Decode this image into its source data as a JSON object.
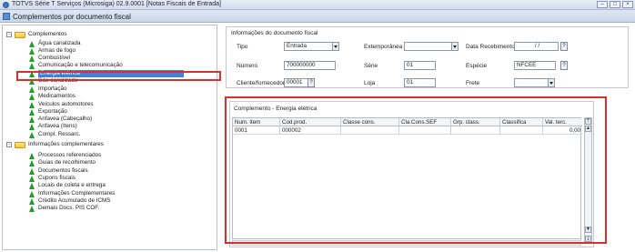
{
  "window": {
    "title": "TOTVS Série T Serviços (Microsiga) 02.9.0001 [Notas Fiscais de Entrada]",
    "min_label": "–",
    "max_label": "□",
    "close_label": "×"
  },
  "header": {
    "title": "Complementos por documento fiscal"
  },
  "tree": {
    "root1": "Complementos",
    "items1": [
      "Água canalizada",
      "Armas de fogo",
      "Combustível",
      "Comunicação e telecomunicação",
      "Energia elétrica",
      "Gás canalizado",
      "Importação",
      "Medicamentos",
      "Veículos automotores",
      "Exportação",
      "Anfavea (Cabeçalho)",
      "Anfavea (Itens)",
      "Compl. Ressarc."
    ],
    "root2": "Informações complementares",
    "items2": [
      "Processos referenciados",
      "Guias de recolhimento",
      "Documentos fiscais",
      "Cupons fiscais",
      "Locais de coleta e entrega",
      "Informações Complementares",
      "Crédito Acumulado de ICMS",
      "Demais Docs. PIS COF."
    ],
    "expander": "-"
  },
  "doc_info": {
    "title": "Informações do documento fiscal",
    "tipo_label": "Tipo",
    "tipo_value": "Entrada",
    "extemporanea_label": "Extemporânea",
    "extemporanea_value": "",
    "data_recebimento_label": "Data Recebimento",
    "data_recebimento_value": "/ /",
    "numero_label": "Número",
    "numero_value": "700000000",
    "serie_label": "Série",
    "serie_value": "01",
    "especie_label": "Espécie",
    "especie_value": "NFCEE",
    "cliente_label": "Cliente/fornecedor",
    "cliente_value": "00001",
    "loja_label": "Loja",
    "loja_value": "01",
    "frete_label": "Frete",
    "frete_value": "",
    "lookup_label": "?"
  },
  "complement": {
    "title": "Complemento - Energia elétrica",
    "columns": [
      "Num. item",
      "Cod.prod.",
      "Classe cons.",
      "Cla.Cons.SEF",
      "Grp. class.",
      "Classifica",
      "Val. terc."
    ],
    "rows": [
      [
        "0001",
        "000002",
        "",
        "",
        "",
        "",
        "0,00"
      ]
    ],
    "scroll_top": "⤒",
    "scroll_up": "▲",
    "scroll_down": "▼",
    "scroll_bottom": "⤓"
  }
}
